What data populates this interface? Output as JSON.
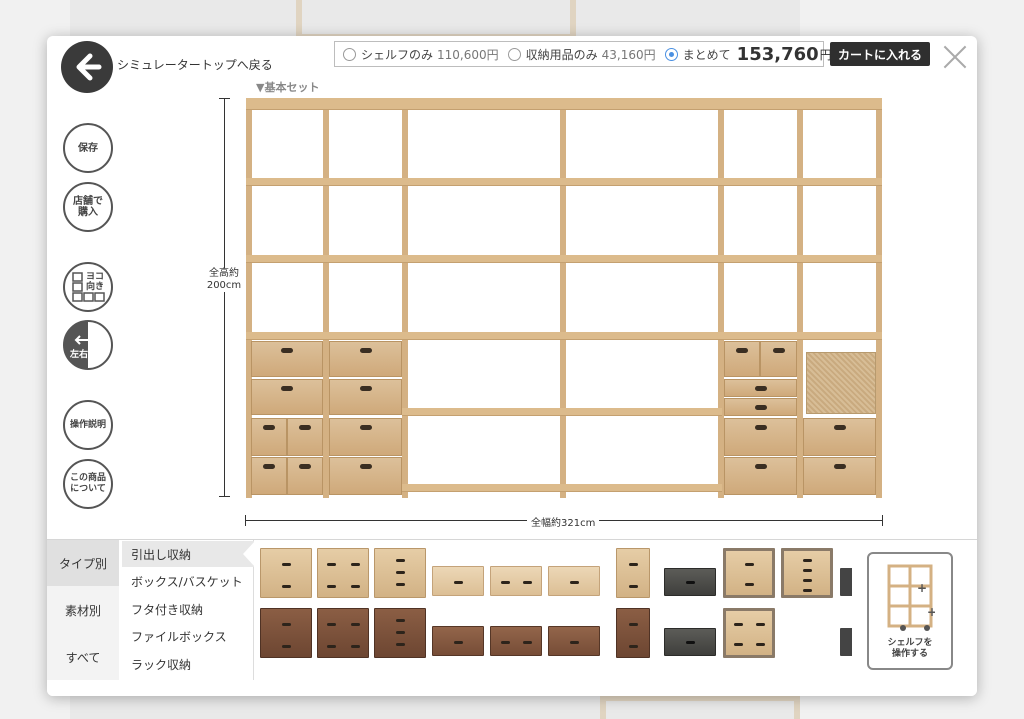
{
  "header": {
    "back_label": "シミュレータートップへ戻る",
    "options": [
      {
        "label": "シェルフのみ",
        "price": "110,600円",
        "selected": false
      },
      {
        "label": "収納用品のみ",
        "price": "43,160円",
        "selected": false
      },
      {
        "label": "まとめて",
        "price": "153,760",
        "currency": "円",
        "selected": true
      }
    ],
    "cart_label": "カートに入れる"
  },
  "tools": {
    "save": "保存",
    "store": "店舗で購入",
    "yoko": "ヨコ向き",
    "flip": "左右反転",
    "help": "操作説明",
    "about": "この商品について"
  },
  "shelf": {
    "set_label": "▼基本セット",
    "height_label_1": "全高約",
    "height_label_2": "200cm",
    "width_label": "全幅約321cm"
  },
  "bottom": {
    "tabs": [
      "タイプ別",
      "素材別",
      "すべて"
    ],
    "categories": [
      "引出し収納",
      "ボックス/バスケット",
      "フタ付き収納",
      "ファイルボックス",
      "ラック収納"
    ],
    "operate_label_1": "シェルフを",
    "operate_label_2": "操作する"
  }
}
